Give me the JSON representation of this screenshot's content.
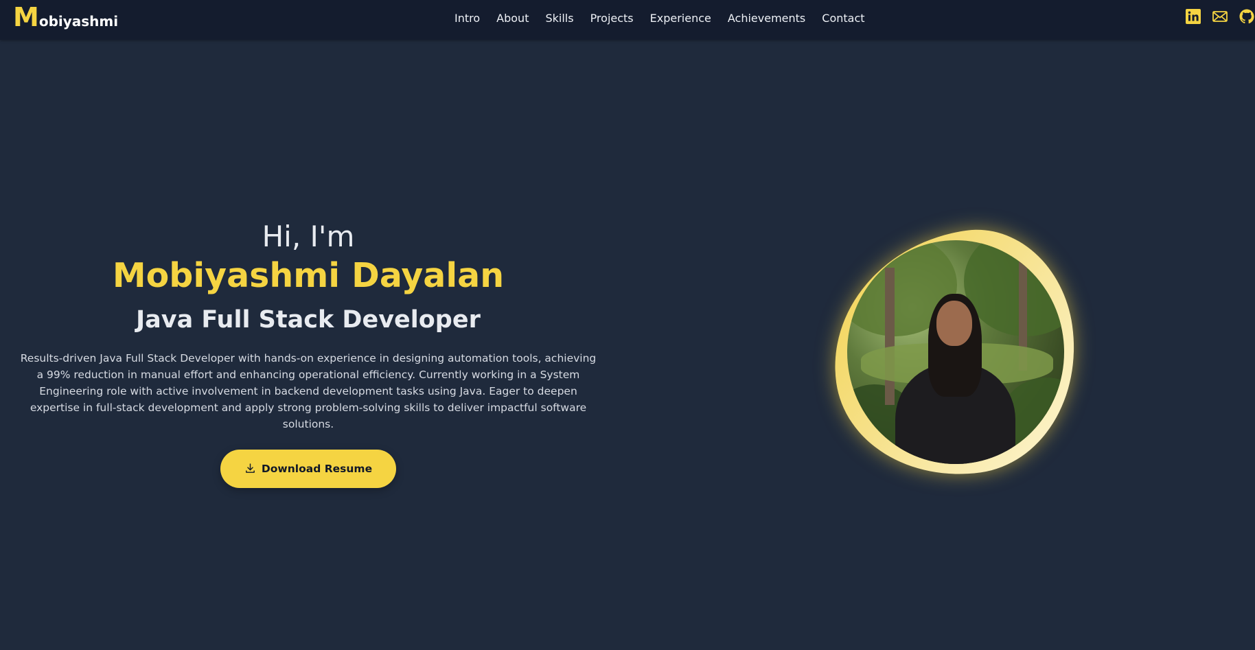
{
  "logo": {
    "initial": "M",
    "rest": "obiyashmi"
  },
  "nav": {
    "links": [
      "Intro",
      "About",
      "Skills",
      "Projects",
      "Experience",
      "Achievements",
      "Contact"
    ],
    "icons": [
      "linkedin-icon",
      "mail-icon",
      "github-icon"
    ]
  },
  "hero": {
    "greeting": "Hi, I'm",
    "name": "Mobiyashmi Dayalan",
    "role": "Java Full Stack Developer",
    "summary": "Results-driven Java Full Stack Developer with hands-on experience in designing automation tools, achieving a 99% reduction in manual effort and enhancing operational efficiency. Currently working in a System Engineering role with active involvement in backend development tasks using Java. Eager to deepen expertise in full-stack development and apply strong problem-solving skills to deliver impactful software solutions.",
    "button_label": "Download Resume",
    "button_icon": "download-icon"
  },
  "colors": {
    "accent": "#f5d442",
    "background": "#1f2a3c",
    "navbar": "#141c2e",
    "text": "#e8ebf0"
  }
}
